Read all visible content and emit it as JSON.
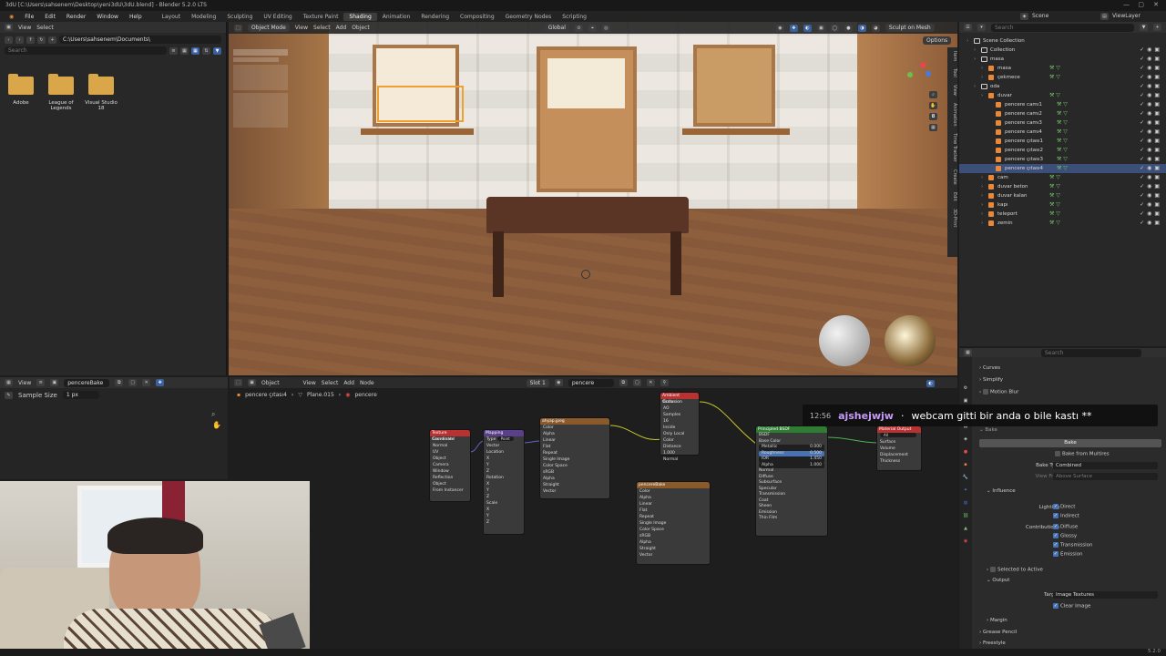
{
  "window": {
    "title": "3dU [C:\\Users\\sahsenem\\Desktop\\yeni3dU\\3dU.blend] - Blender 5.2.0 LTS"
  },
  "menubar": {
    "menus": [
      "File",
      "Edit",
      "Render",
      "Window",
      "Help"
    ],
    "workspaces": [
      "Layout",
      "Modeling",
      "Sculpting",
      "UV Editing",
      "Texture Paint",
      "Shading",
      "Animation",
      "Rendering",
      "Compositing",
      "Geometry Nodes",
      "Scripting"
    ],
    "active_workspace": "Shading",
    "scene": "Scene",
    "view_layer": "ViewLayer"
  },
  "file_browser": {
    "view": "View",
    "select": "Select",
    "path": "C:\\Users\\sahsenem\\Documents\\",
    "search_placeholder": "Search",
    "folders": [
      "Adobe",
      "League of Legends",
      "Visual Studio 18"
    ]
  },
  "viewport": {
    "mode": "Object Mode",
    "menus": [
      "View",
      "Select",
      "Add",
      "Object"
    ],
    "orientation": "Global",
    "sculpt_label": "Sculpt on Mesh",
    "options": "Options",
    "side_tabs": [
      "Item",
      "Tool",
      "View",
      "Animation",
      "Time Tracker",
      "Create",
      "Edit",
      "3D-Print"
    ]
  },
  "outliner": {
    "search_placeholder": "Search",
    "rows": [
      {
        "label": "Scene Collection",
        "depth": 0,
        "kind": "scene"
      },
      {
        "label": "Collection",
        "depth": 1,
        "kind": "collection"
      },
      {
        "label": "masa",
        "depth": 1,
        "kind": "collection"
      },
      {
        "label": "masa",
        "depth": 2,
        "kind": "object"
      },
      {
        "label": "çekmece",
        "depth": 2,
        "kind": "object"
      },
      {
        "label": "oda",
        "depth": 1,
        "kind": "collection"
      },
      {
        "label": "duvar",
        "depth": 2,
        "kind": "object"
      },
      {
        "label": "pencere camı1",
        "depth": 3,
        "kind": "object"
      },
      {
        "label": "pencere camı2",
        "depth": 3,
        "kind": "object"
      },
      {
        "label": "pencere camı3",
        "depth": 3,
        "kind": "object"
      },
      {
        "label": "pencere camı4",
        "depth": 3,
        "kind": "object"
      },
      {
        "label": "pencere çıtası1",
        "depth": 3,
        "kind": "object"
      },
      {
        "label": "pencere çıtası2",
        "depth": 3,
        "kind": "object"
      },
      {
        "label": "pencere çıtası3",
        "depth": 3,
        "kind": "object"
      },
      {
        "label": "pencere çıtası4",
        "depth": 3,
        "kind": "object",
        "selected": true
      },
      {
        "label": "cam",
        "depth": 2,
        "kind": "object"
      },
      {
        "label": "duvar beton",
        "depth": 2,
        "kind": "object"
      },
      {
        "label": "duvar kalan",
        "depth": 2,
        "kind": "object"
      },
      {
        "label": "kapı",
        "depth": 2,
        "kind": "object"
      },
      {
        "label": "teleport",
        "depth": 2,
        "kind": "object"
      },
      {
        "label": "zemin",
        "depth": 2,
        "kind": "object"
      }
    ]
  },
  "properties": {
    "search_placeholder": "Search",
    "panels_top": [
      "Curves",
      "Simplify",
      "Motion Blur"
    ],
    "bake_section": "Bake",
    "bake_button": "Bake",
    "bake_from_multires": "Bake from Multires",
    "bake_type_label": "Bake Type",
    "bake_type_value": "Combined",
    "view_from_label": "View From",
    "view_from_value": "Above Surface",
    "influence": "Influence",
    "lighting_label": "Lighting",
    "lighting": [
      "Direct",
      "Indirect"
    ],
    "contributions_label": "Contributions",
    "contributions": [
      "Diffuse",
      "Glossy",
      "Transmission",
      "Emission"
    ],
    "selected_to_active": "Selected to Active",
    "output": "Output",
    "target_label": "Target",
    "target_value": "Image Textures",
    "clear_image": "Clear Image",
    "margin": "Margin",
    "grease_pencil": "Grease Pencil",
    "freestyle": "Freestyle"
  },
  "node_left": {
    "view": "View",
    "image_name": "pencereBake",
    "sample_size_label": "Sample Size",
    "sample_size_value": "1 px"
  },
  "node_editor": {
    "mode": "Object",
    "menus": [
      "View",
      "Select",
      "Add",
      "Node"
    ],
    "slot": "Slot 1",
    "material": "pencere",
    "breadcrumb": [
      "pencere çıtası4",
      "Plane.015",
      "pencere"
    ],
    "nodes": {
      "texcoord": {
        "title": "Texture Coordinate",
        "rows": [
          "Generated",
          "Normal",
          "UV",
          "Object",
          "Camera",
          "Window",
          "Reflection",
          "Object",
          "From Instancer"
        ]
      },
      "mapping": {
        "title": "Mapping",
        "type_label": "Type",
        "type_value": "Point",
        "rows": [
          "Vector",
          "Location",
          "X",
          "Y",
          "Z",
          "Rotation",
          "X",
          "Y",
          "Z",
          "Scale",
          "X",
          "Y",
          "Z"
        ],
        "loc": [
          "0 m",
          "0 m",
          "0 m"
        ],
        "rot": [
          "0°",
          "0°",
          "0°"
        ],
        "scale": [
          "1.000",
          "1.000",
          "1.000"
        ]
      },
      "image1": {
        "title": "ahşap.jpeg",
        "image": "ahşap.jpeg",
        "rows": [
          "Color",
          "Alpha",
          "Linear",
          "Flat",
          "Repeat",
          "Single Image",
          "Color Space",
          "sRGB",
          "Alpha",
          "Straight",
          "Vector"
        ]
      },
      "ao": {
        "title": "Ambient Occlusion",
        "rows": [
          "Color",
          "AO",
          "Samples",
          "16",
          "Inside",
          "Only Local",
          "Color",
          "Distance",
          "1.000",
          "Normal"
        ]
      },
      "image2": {
        "title": "pencereBake",
        "image": "pencereBake",
        "rows": [
          "Color",
          "Alpha",
          "Linear",
          "Flat",
          "Repeat",
          "Single Image",
          "Color Space",
          "sRGB",
          "Alpha",
          "Straight",
          "Vector"
        ]
      },
      "bsdf": {
        "title": "Principled BSDF",
        "rows": [
          "BSDF",
          "Base Color",
          "Metallic",
          "Roughness",
          "IOR",
          "Alpha",
          "Normal",
          "Diffuse",
          "Subsurface",
          "Specular",
          "Transmission",
          "Coat",
          "Sheen",
          "Emission",
          "Thin Film"
        ],
        "values": [
          "0.000",
          "0.500",
          "1.450",
          "1.000"
        ]
      },
      "output": {
        "title": "Material Output",
        "all": "All",
        "rows": [
          "Surface",
          "Volume",
          "Displacement",
          "Thickness"
        ]
      }
    }
  },
  "chat": {
    "time": "12:56",
    "user": "ajshejwjw",
    "message": "webcam gitti bir anda o bile kastı **"
  },
  "status": {
    "version": "5.2.0"
  },
  "colors": {
    "accent": "#4772b3",
    "object_orange": "#e8893a",
    "selected_row": "#3c4f78",
    "modifier_green": "#76c56a",
    "chat_user": "#c79cf8"
  }
}
